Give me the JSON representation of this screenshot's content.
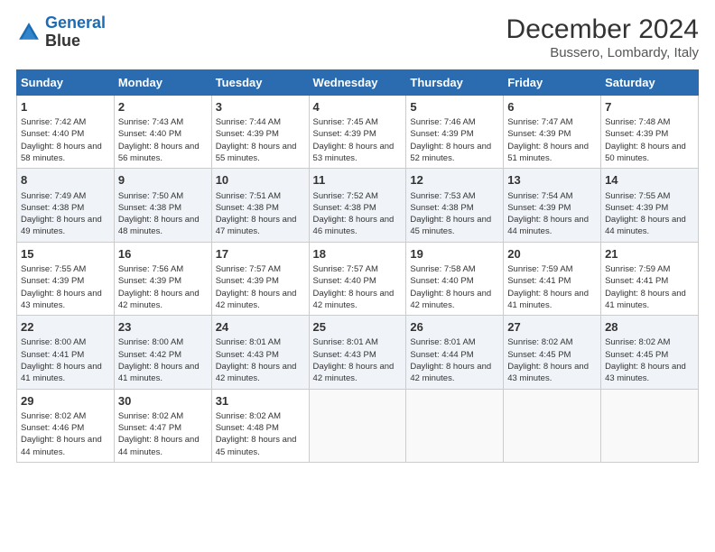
{
  "header": {
    "logo_line1": "General",
    "logo_line2": "Blue",
    "month": "December 2024",
    "location": "Bussero, Lombardy, Italy"
  },
  "days_of_week": [
    "Sunday",
    "Monday",
    "Tuesday",
    "Wednesday",
    "Thursday",
    "Friday",
    "Saturday"
  ],
  "weeks": [
    [
      {
        "day": 1,
        "sunrise": "7:42 AM",
        "sunset": "4:40 PM",
        "daylight": "8 hours and 58 minutes."
      },
      {
        "day": 2,
        "sunrise": "7:43 AM",
        "sunset": "4:40 PM",
        "daylight": "8 hours and 56 minutes."
      },
      {
        "day": 3,
        "sunrise": "7:44 AM",
        "sunset": "4:39 PM",
        "daylight": "8 hours and 55 minutes."
      },
      {
        "day": 4,
        "sunrise": "7:45 AM",
        "sunset": "4:39 PM",
        "daylight": "8 hours and 53 minutes."
      },
      {
        "day": 5,
        "sunrise": "7:46 AM",
        "sunset": "4:39 PM",
        "daylight": "8 hours and 52 minutes."
      },
      {
        "day": 6,
        "sunrise": "7:47 AM",
        "sunset": "4:39 PM",
        "daylight": "8 hours and 51 minutes."
      },
      {
        "day": 7,
        "sunrise": "7:48 AM",
        "sunset": "4:39 PM",
        "daylight": "8 hours and 50 minutes."
      }
    ],
    [
      {
        "day": 8,
        "sunrise": "7:49 AM",
        "sunset": "4:38 PM",
        "daylight": "8 hours and 49 minutes."
      },
      {
        "day": 9,
        "sunrise": "7:50 AM",
        "sunset": "4:38 PM",
        "daylight": "8 hours and 48 minutes."
      },
      {
        "day": 10,
        "sunrise": "7:51 AM",
        "sunset": "4:38 PM",
        "daylight": "8 hours and 47 minutes."
      },
      {
        "day": 11,
        "sunrise": "7:52 AM",
        "sunset": "4:38 PM",
        "daylight": "8 hours and 46 minutes."
      },
      {
        "day": 12,
        "sunrise": "7:53 AM",
        "sunset": "4:38 PM",
        "daylight": "8 hours and 45 minutes."
      },
      {
        "day": 13,
        "sunrise": "7:54 AM",
        "sunset": "4:39 PM",
        "daylight": "8 hours and 44 minutes."
      },
      {
        "day": 14,
        "sunrise": "7:55 AM",
        "sunset": "4:39 PM",
        "daylight": "8 hours and 44 minutes."
      }
    ],
    [
      {
        "day": 15,
        "sunrise": "7:55 AM",
        "sunset": "4:39 PM",
        "daylight": "8 hours and 43 minutes."
      },
      {
        "day": 16,
        "sunrise": "7:56 AM",
        "sunset": "4:39 PM",
        "daylight": "8 hours and 42 minutes."
      },
      {
        "day": 17,
        "sunrise": "7:57 AM",
        "sunset": "4:39 PM",
        "daylight": "8 hours and 42 minutes."
      },
      {
        "day": 18,
        "sunrise": "7:57 AM",
        "sunset": "4:40 PM",
        "daylight": "8 hours and 42 minutes."
      },
      {
        "day": 19,
        "sunrise": "7:58 AM",
        "sunset": "4:40 PM",
        "daylight": "8 hours and 42 minutes."
      },
      {
        "day": 20,
        "sunrise": "7:59 AM",
        "sunset": "4:41 PM",
        "daylight": "8 hours and 41 minutes."
      },
      {
        "day": 21,
        "sunrise": "7:59 AM",
        "sunset": "4:41 PM",
        "daylight": "8 hours and 41 minutes."
      }
    ],
    [
      {
        "day": 22,
        "sunrise": "8:00 AM",
        "sunset": "4:41 PM",
        "daylight": "8 hours and 41 minutes."
      },
      {
        "day": 23,
        "sunrise": "8:00 AM",
        "sunset": "4:42 PM",
        "daylight": "8 hours and 41 minutes."
      },
      {
        "day": 24,
        "sunrise": "8:01 AM",
        "sunset": "4:43 PM",
        "daylight": "8 hours and 42 minutes."
      },
      {
        "day": 25,
        "sunrise": "8:01 AM",
        "sunset": "4:43 PM",
        "daylight": "8 hours and 42 minutes."
      },
      {
        "day": 26,
        "sunrise": "8:01 AM",
        "sunset": "4:44 PM",
        "daylight": "8 hours and 42 minutes."
      },
      {
        "day": 27,
        "sunrise": "8:02 AM",
        "sunset": "4:45 PM",
        "daylight": "8 hours and 43 minutes."
      },
      {
        "day": 28,
        "sunrise": "8:02 AM",
        "sunset": "4:45 PM",
        "daylight": "8 hours and 43 minutes."
      }
    ],
    [
      {
        "day": 29,
        "sunrise": "8:02 AM",
        "sunset": "4:46 PM",
        "daylight": "8 hours and 44 minutes."
      },
      {
        "day": 30,
        "sunrise": "8:02 AM",
        "sunset": "4:47 PM",
        "daylight": "8 hours and 44 minutes."
      },
      {
        "day": 31,
        "sunrise": "8:02 AM",
        "sunset": "4:48 PM",
        "daylight": "8 hours and 45 minutes."
      },
      null,
      null,
      null,
      null
    ]
  ]
}
